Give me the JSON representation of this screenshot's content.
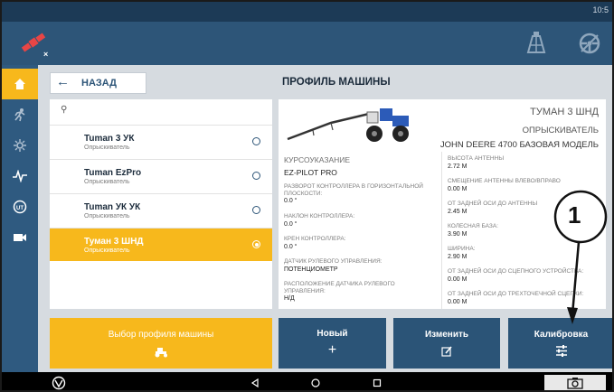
{
  "status": {
    "time": "10:5"
  },
  "topbar": {
    "left_icon": "satellite-off-icon",
    "right_icons": [
      "field-grid-icon",
      "steering-wheel-icon"
    ]
  },
  "sidebar": {
    "items": [
      {
        "icon": "home-icon",
        "active": true
      },
      {
        "icon": "sprayer-run-icon"
      },
      {
        "icon": "settings-sliders-icon"
      },
      {
        "icon": "pulse-icon"
      },
      {
        "icon": "gps-receiver-icon"
      },
      {
        "icon": "video-camera-icon"
      }
    ]
  },
  "header": {
    "back_label": "НАЗАД",
    "title": "ПРОФИЛЬ МАШИНЫ"
  },
  "vehicle_list": {
    "items": [
      {
        "name": "Tuman 3 УК",
        "type": "Опрыскиватель",
        "selected": false
      },
      {
        "name": "Tuman EzPro",
        "type": "Опрыскиватель",
        "selected": false
      },
      {
        "name": "Tuman УК УК",
        "type": "Опрыскиватель",
        "selected": false
      },
      {
        "name": "Туман 3 ШНД",
        "type": "Опрыскиватель",
        "selected": true
      }
    ]
  },
  "profile": {
    "name": "ТУМАН 3 ШНД",
    "type": "ОПРЫСКИВАТЕЛЬ",
    "model": "JOHN DEERE 4700 БАЗОВАЯ МОДЕЛЬ",
    "left": [
      {
        "label": "КУРСОУКАЗАНИЕ",
        "value": "EZ-PILOT PRO"
      },
      {
        "label": "РАЗВОРОТ КОНТРОЛЛЕРА В ГОРИЗОНТАЛЬНОЙ ПЛОСКОСТИ:",
        "value": "0.0 °"
      },
      {
        "label": "НАКЛОН КОНТРОЛЛЕРА:",
        "value": "0.0 °"
      },
      {
        "label": "КРЕН КОНТРОЛЛЕРА:",
        "value": "0.0 °"
      },
      {
        "label": "ДАТЧИК РУЛЕВОГО УПРАВЛЕНИЯ:",
        "value": "ПОТЕНЦИОМЕТР"
      },
      {
        "label": "РАСПОЛОЖЕНИЕ ДАТЧИКА РУЛЕВОГО УПРАВЛЕНИЯ:",
        "value": "Н/Д"
      }
    ],
    "right": [
      {
        "label": "ВЫСОТА АНТЕННЫ",
        "value": "2.72 M"
      },
      {
        "label": "СМЕЩЕНИЕ АНТЕННЫ ВЛЕВО/ВПРАВО",
        "value": "0.00 M"
      },
      {
        "label": "ОТ ЗАДНЕЙ ОСИ ДО АНТЕННЫ",
        "value": "2.45 M"
      },
      {
        "label": "КОЛЕСНАЯ БАЗА:",
        "value": "3.90 M"
      },
      {
        "label": "ШИРИНА:",
        "value": "2.90 M"
      },
      {
        "label": "ОТ ЗАДНЕЙ ОСИ ДО СЦЕПНОГО УСТРОЙСТВА:",
        "value": "0.00 M"
      },
      {
        "label": "ОТ ЗАДНЕЙ ОСИ ДО ТРЕХТОЧЕЧНОЙ СЦЕПКИ:",
        "value": "0.00 M"
      }
    ]
  },
  "buttons": {
    "select_profile": "Выбор профиля машины",
    "new": "Новый",
    "edit": "Изменить",
    "calibrate": "Калибровка"
  },
  "annotation": {
    "callout_number": "1"
  },
  "navbar": {
    "icons": [
      "brand-logo-icon",
      "back-triangle-icon",
      "home-circle-icon",
      "recents-square-icon",
      "screenshot-camera-icon"
    ]
  },
  "colors": {
    "accent": "#f7b81c",
    "primary": "#2d5578",
    "button_blue": "#2b5477"
  }
}
